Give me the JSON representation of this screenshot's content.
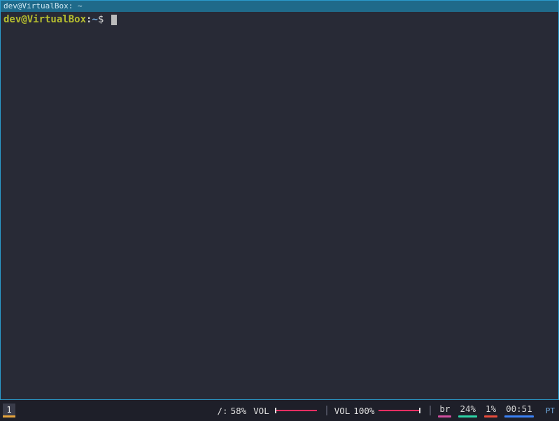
{
  "window": {
    "title": "dev@VirtualBox: ~"
  },
  "prompt": {
    "user_host": "dev@VirtualBox",
    "colon": ":",
    "path": "~",
    "symbol": "$"
  },
  "statusbar": {
    "workspace": "1",
    "disk": {
      "label": "/:",
      "value": "58%"
    },
    "vol1": {
      "label": "VOL"
    },
    "vol2": {
      "label": "VOL",
      "value": "100%"
    },
    "net": {
      "label": "br"
    },
    "battery": {
      "value": "24%"
    },
    "cpu": {
      "value": "1%"
    },
    "clock": {
      "value": "00:51"
    },
    "keyboard": {
      "value": "PT"
    }
  },
  "colors": {
    "accent": "#2a9acb",
    "prompt_user": "#b5bd2f",
    "prompt_path": "#6fa8dc",
    "vol_slider": "#ff2e63",
    "ul_net": "#d04f9e",
    "ul_battery": "#2dd4a7",
    "ul_cpu": "#e74c3c",
    "ul_clock": "#3b82f6"
  }
}
